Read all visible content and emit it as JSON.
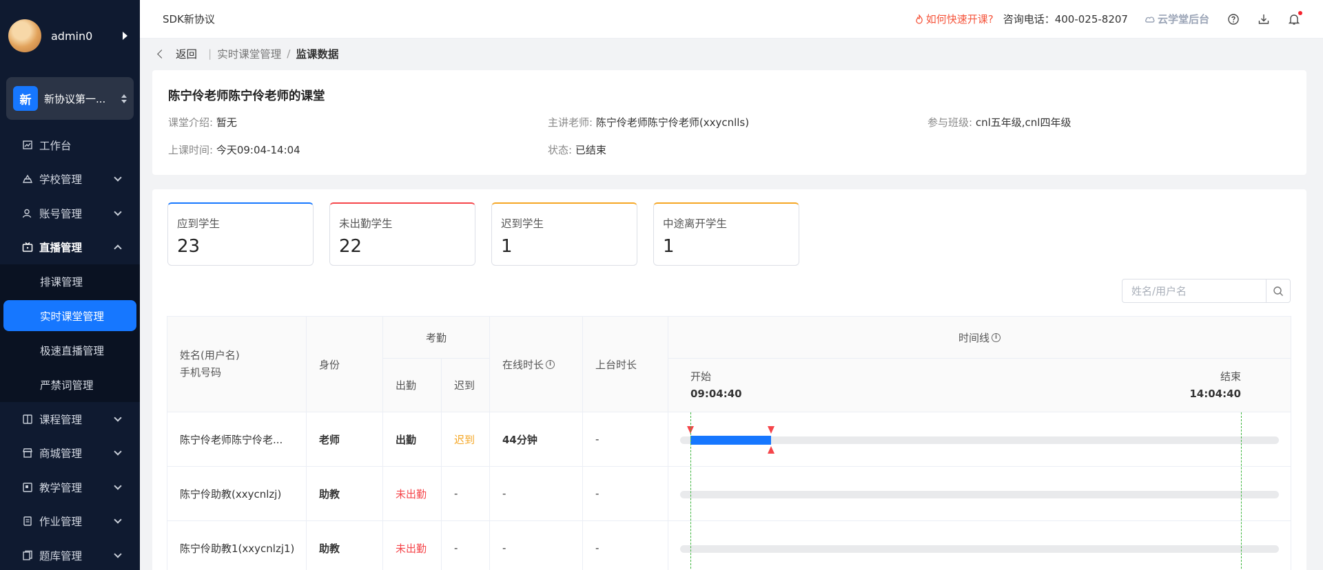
{
  "sidebar": {
    "username": "admin0",
    "school_badge": "新",
    "school_name": "新协议第一...",
    "menu": [
      {
        "label": "工作台",
        "icon": "chart-icon",
        "expandable": false
      },
      {
        "label": "学校管理",
        "icon": "school-icon",
        "expandable": true
      },
      {
        "label": "账号管理",
        "icon": "user-icon",
        "expandable": true
      },
      {
        "label": "直播管理",
        "icon": "live-icon",
        "expandable": true,
        "open": true
      }
    ],
    "submenu": [
      {
        "label": "排课管理"
      },
      {
        "label": "实时课堂管理",
        "active": true
      },
      {
        "label": "极速直播管理"
      },
      {
        "label": "严禁词管理"
      }
    ],
    "menu_after": [
      {
        "label": "课程管理",
        "icon": "book-icon"
      },
      {
        "label": "商城管理",
        "icon": "shop-icon"
      },
      {
        "label": "教学管理",
        "icon": "teach-icon"
      },
      {
        "label": "作业管理",
        "icon": "homework-icon"
      },
      {
        "label": "题库管理",
        "icon": "question-bank-icon"
      }
    ]
  },
  "topbar": {
    "app_title": "SDK新协议",
    "hot_link": "如何快速开课?",
    "phone": "咨询电话：400-025-8207",
    "backend": "云学堂后台",
    "accent": "#f5543b"
  },
  "breadcrumb": {
    "back": "返回",
    "parent": "实时课堂管理",
    "sep": "/",
    "current": "监课数据"
  },
  "course": {
    "title": "陈宁伶老师陈宁伶老师的课堂",
    "intro_label": "课堂介绍:",
    "intro_value": "暂无",
    "teacher_label": "主讲老师:",
    "teacher_value": "陈宁伶老师陈宁伶老师(xxycnlls)",
    "class_label": "参与班级:",
    "class_value": "cnl五年级,cnl四年级",
    "time_label": "上课时间:",
    "time_value": "今天09:04-14:04",
    "status_label": "状态:",
    "status_value": "已结束"
  },
  "stats": [
    {
      "label": "应到学生",
      "value": "23",
      "color": "#1677ff"
    },
    {
      "label": "未出勤学生",
      "value": "22",
      "color": "#f5454a"
    },
    {
      "label": "迟到学生",
      "value": "1",
      "color": "#f5a623"
    },
    {
      "label": "中途离开学生",
      "value": "1",
      "color": "#f5a623"
    }
  ],
  "search": {
    "placeholder": "姓名/用户名"
  },
  "table": {
    "headers": {
      "name": "姓名(用户名)",
      "phone": "手机号码",
      "role": "身份",
      "attendance": "考勤",
      "present": "出勤",
      "late": "迟到",
      "online": "在线时长",
      "stage": "上台时长",
      "timeline": "时间线",
      "start_label": "开始",
      "start_time": "09:04:40",
      "end_label": "结束",
      "end_time": "14:04:40"
    },
    "rows": [
      {
        "name": "陈宁伶老师陈宁伶老...",
        "role": "老师",
        "present": "出勤",
        "late": "迟到",
        "online": "44分钟",
        "stage": "-",
        "seg_start": 0.0,
        "seg_end": 0.147
      },
      {
        "name": "陈宁伶助教(xxycnlzj)",
        "role": "助教",
        "present": "未出勤",
        "late": "-",
        "online": "-",
        "stage": "-",
        "seg_start": null,
        "seg_end": null
      },
      {
        "name": "陈宁伶助教1(xxycnlzj1)",
        "role": "助教",
        "present": "未出勤",
        "late": "-",
        "online": "-",
        "stage": "-",
        "seg_start": null,
        "seg_end": null
      }
    ],
    "colors": {
      "absent": "#f5454a",
      "late": "#f5a623",
      "bar": "#1677ff",
      "marker": "#f5454a",
      "guide": "#3bb53b"
    }
  }
}
